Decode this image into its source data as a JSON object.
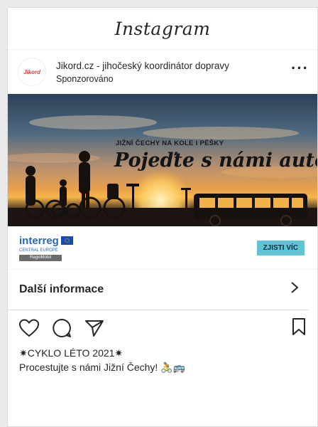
{
  "app": {
    "name": "Instagram"
  },
  "post": {
    "avatar_text": "Jikord",
    "account": "Jikord.cz - jihočeský koordinátor dopravy",
    "sponsored": "Sponzorováno",
    "more_icon": "more-horizontal-icon"
  },
  "hero": {
    "subtitle": "JIŽNÍ ČECHY NA KOLE I PĚŠKY",
    "title": "Pojeďte s námi autobusem!"
  },
  "banner": {
    "brand": "interreg",
    "sub": "CENTRAL EUROPE",
    "tag": "RegioMobil",
    "cta": "ZJISTI VÍC"
  },
  "more_info": {
    "label": "Další informace"
  },
  "caption": {
    "line1": "✷CYKLO LÉTO 2021✷",
    "line2": "Procestujte s námi Jižní Čechy! 🚴🚌"
  },
  "icons": [
    "heart-icon",
    "comment-icon",
    "share-icon",
    "bookmark-icon",
    "chevron-right-icon"
  ]
}
